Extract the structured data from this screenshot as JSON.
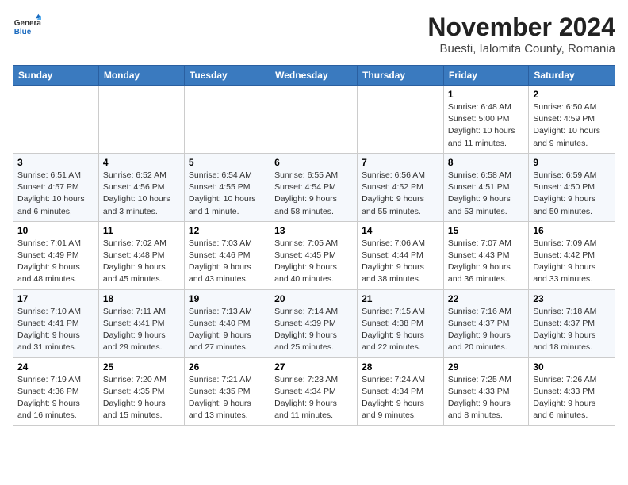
{
  "header": {
    "logo_general": "General",
    "logo_blue": "Blue",
    "title": "November 2024",
    "subtitle": "Buesti, Ialomita County, Romania"
  },
  "weekdays": [
    "Sunday",
    "Monday",
    "Tuesday",
    "Wednesday",
    "Thursday",
    "Friday",
    "Saturday"
  ],
  "weeks": [
    [
      {
        "day": "",
        "info": ""
      },
      {
        "day": "",
        "info": ""
      },
      {
        "day": "",
        "info": ""
      },
      {
        "day": "",
        "info": ""
      },
      {
        "day": "",
        "info": ""
      },
      {
        "day": "1",
        "info": "Sunrise: 6:48 AM\nSunset: 5:00 PM\nDaylight: 10 hours and 11 minutes."
      },
      {
        "day": "2",
        "info": "Sunrise: 6:50 AM\nSunset: 4:59 PM\nDaylight: 10 hours and 9 minutes."
      }
    ],
    [
      {
        "day": "3",
        "info": "Sunrise: 6:51 AM\nSunset: 4:57 PM\nDaylight: 10 hours and 6 minutes."
      },
      {
        "day": "4",
        "info": "Sunrise: 6:52 AM\nSunset: 4:56 PM\nDaylight: 10 hours and 3 minutes."
      },
      {
        "day": "5",
        "info": "Sunrise: 6:54 AM\nSunset: 4:55 PM\nDaylight: 10 hours and 1 minute."
      },
      {
        "day": "6",
        "info": "Sunrise: 6:55 AM\nSunset: 4:54 PM\nDaylight: 9 hours and 58 minutes."
      },
      {
        "day": "7",
        "info": "Sunrise: 6:56 AM\nSunset: 4:52 PM\nDaylight: 9 hours and 55 minutes."
      },
      {
        "day": "8",
        "info": "Sunrise: 6:58 AM\nSunset: 4:51 PM\nDaylight: 9 hours and 53 minutes."
      },
      {
        "day": "9",
        "info": "Sunrise: 6:59 AM\nSunset: 4:50 PM\nDaylight: 9 hours and 50 minutes."
      }
    ],
    [
      {
        "day": "10",
        "info": "Sunrise: 7:01 AM\nSunset: 4:49 PM\nDaylight: 9 hours and 48 minutes."
      },
      {
        "day": "11",
        "info": "Sunrise: 7:02 AM\nSunset: 4:48 PM\nDaylight: 9 hours and 45 minutes."
      },
      {
        "day": "12",
        "info": "Sunrise: 7:03 AM\nSunset: 4:46 PM\nDaylight: 9 hours and 43 minutes."
      },
      {
        "day": "13",
        "info": "Sunrise: 7:05 AM\nSunset: 4:45 PM\nDaylight: 9 hours and 40 minutes."
      },
      {
        "day": "14",
        "info": "Sunrise: 7:06 AM\nSunset: 4:44 PM\nDaylight: 9 hours and 38 minutes."
      },
      {
        "day": "15",
        "info": "Sunrise: 7:07 AM\nSunset: 4:43 PM\nDaylight: 9 hours and 36 minutes."
      },
      {
        "day": "16",
        "info": "Sunrise: 7:09 AM\nSunset: 4:42 PM\nDaylight: 9 hours and 33 minutes."
      }
    ],
    [
      {
        "day": "17",
        "info": "Sunrise: 7:10 AM\nSunset: 4:41 PM\nDaylight: 9 hours and 31 minutes."
      },
      {
        "day": "18",
        "info": "Sunrise: 7:11 AM\nSunset: 4:41 PM\nDaylight: 9 hours and 29 minutes."
      },
      {
        "day": "19",
        "info": "Sunrise: 7:13 AM\nSunset: 4:40 PM\nDaylight: 9 hours and 27 minutes."
      },
      {
        "day": "20",
        "info": "Sunrise: 7:14 AM\nSunset: 4:39 PM\nDaylight: 9 hours and 25 minutes."
      },
      {
        "day": "21",
        "info": "Sunrise: 7:15 AM\nSunset: 4:38 PM\nDaylight: 9 hours and 22 minutes."
      },
      {
        "day": "22",
        "info": "Sunrise: 7:16 AM\nSunset: 4:37 PM\nDaylight: 9 hours and 20 minutes."
      },
      {
        "day": "23",
        "info": "Sunrise: 7:18 AM\nSunset: 4:37 PM\nDaylight: 9 hours and 18 minutes."
      }
    ],
    [
      {
        "day": "24",
        "info": "Sunrise: 7:19 AM\nSunset: 4:36 PM\nDaylight: 9 hours and 16 minutes."
      },
      {
        "day": "25",
        "info": "Sunrise: 7:20 AM\nSunset: 4:35 PM\nDaylight: 9 hours and 15 minutes."
      },
      {
        "day": "26",
        "info": "Sunrise: 7:21 AM\nSunset: 4:35 PM\nDaylight: 9 hours and 13 minutes."
      },
      {
        "day": "27",
        "info": "Sunrise: 7:23 AM\nSunset: 4:34 PM\nDaylight: 9 hours and 11 minutes."
      },
      {
        "day": "28",
        "info": "Sunrise: 7:24 AM\nSunset: 4:34 PM\nDaylight: 9 hours and 9 minutes."
      },
      {
        "day": "29",
        "info": "Sunrise: 7:25 AM\nSunset: 4:33 PM\nDaylight: 9 hours and 8 minutes."
      },
      {
        "day": "30",
        "info": "Sunrise: 7:26 AM\nSunset: 4:33 PM\nDaylight: 9 hours and 6 minutes."
      }
    ]
  ]
}
